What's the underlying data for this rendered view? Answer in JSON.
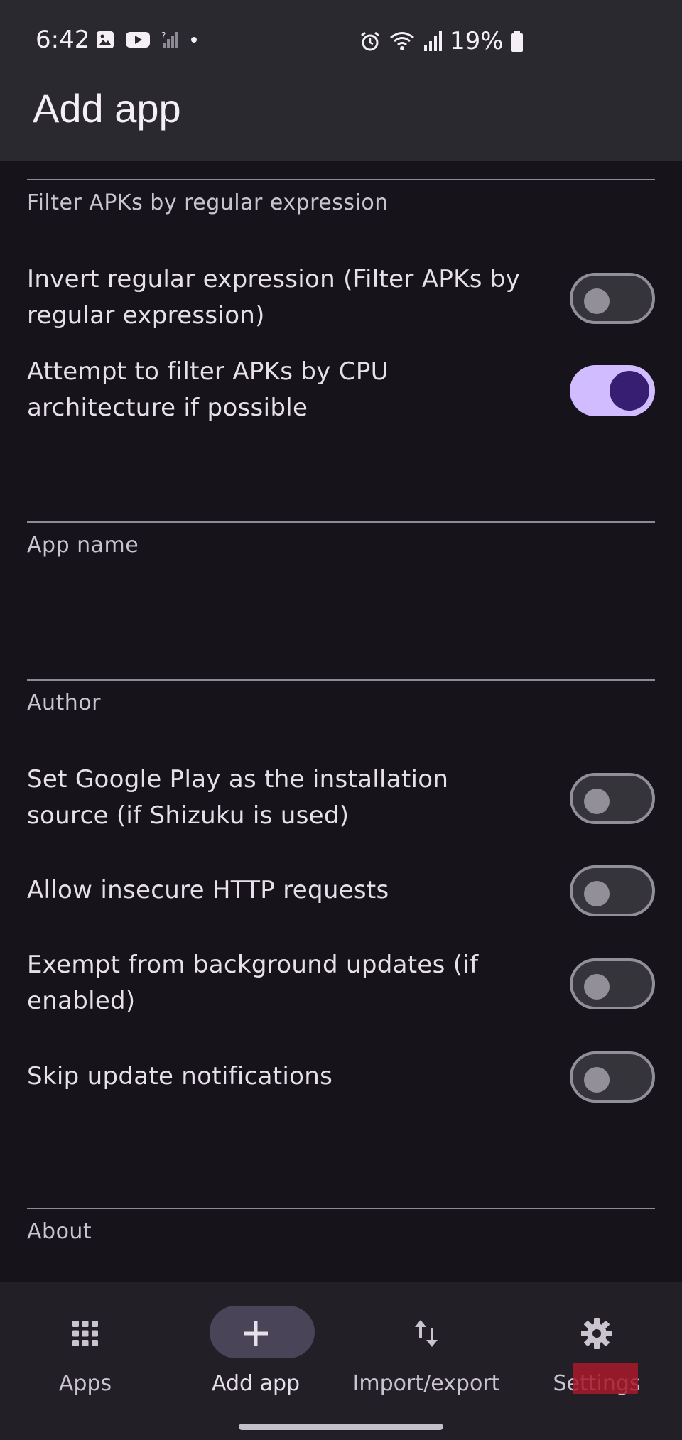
{
  "status_bar": {
    "time": "6:42",
    "battery": "19%",
    "icons": [
      "gallery-icon",
      "youtube-icon",
      "no-signal-icon",
      "dot-icon",
      "alarm-icon",
      "wifi-icon",
      "signal-icon",
      "battery-icon"
    ]
  },
  "app_bar": {
    "title": "Add app"
  },
  "fields": {
    "filter_apks_regex": "Filter APKs by regular expression",
    "app_name": "App name",
    "author": "Author",
    "about": "About"
  },
  "toggles": [
    {
      "label": "Invert regular expression (Filter APKs by regular expression)",
      "checked": false
    },
    {
      "label": "Attempt to filter APKs by CPU architecture if possible",
      "checked": true
    },
    {
      "label": "Set Google Play as the installation source (if Shizuku is used)",
      "checked": false
    },
    {
      "label": "Allow insecure HTTP requests",
      "checked": false
    },
    {
      "label": "Exempt from background updates (if enabled)",
      "checked": false
    },
    {
      "label": "Skip update notifications",
      "checked": false
    }
  ],
  "bottom_nav": {
    "items": [
      {
        "label": "Apps",
        "icon": "grid-icon",
        "active": false
      },
      {
        "label": "Add app",
        "icon": "plus-icon",
        "active": true
      },
      {
        "label": "Import/export",
        "icon": "import-export-icon",
        "active": false
      },
      {
        "label": "Settings",
        "icon": "gear-icon",
        "active": false
      }
    ]
  },
  "colors": {
    "background": "#16131a",
    "bar": "#2b2930",
    "switch_on_track": "#d0bcff",
    "switch_on_thumb": "#381e72",
    "switch_off_track": "#36343b",
    "switch_off_outline": "#938f99",
    "active_nav_pill": "#4a4458"
  }
}
